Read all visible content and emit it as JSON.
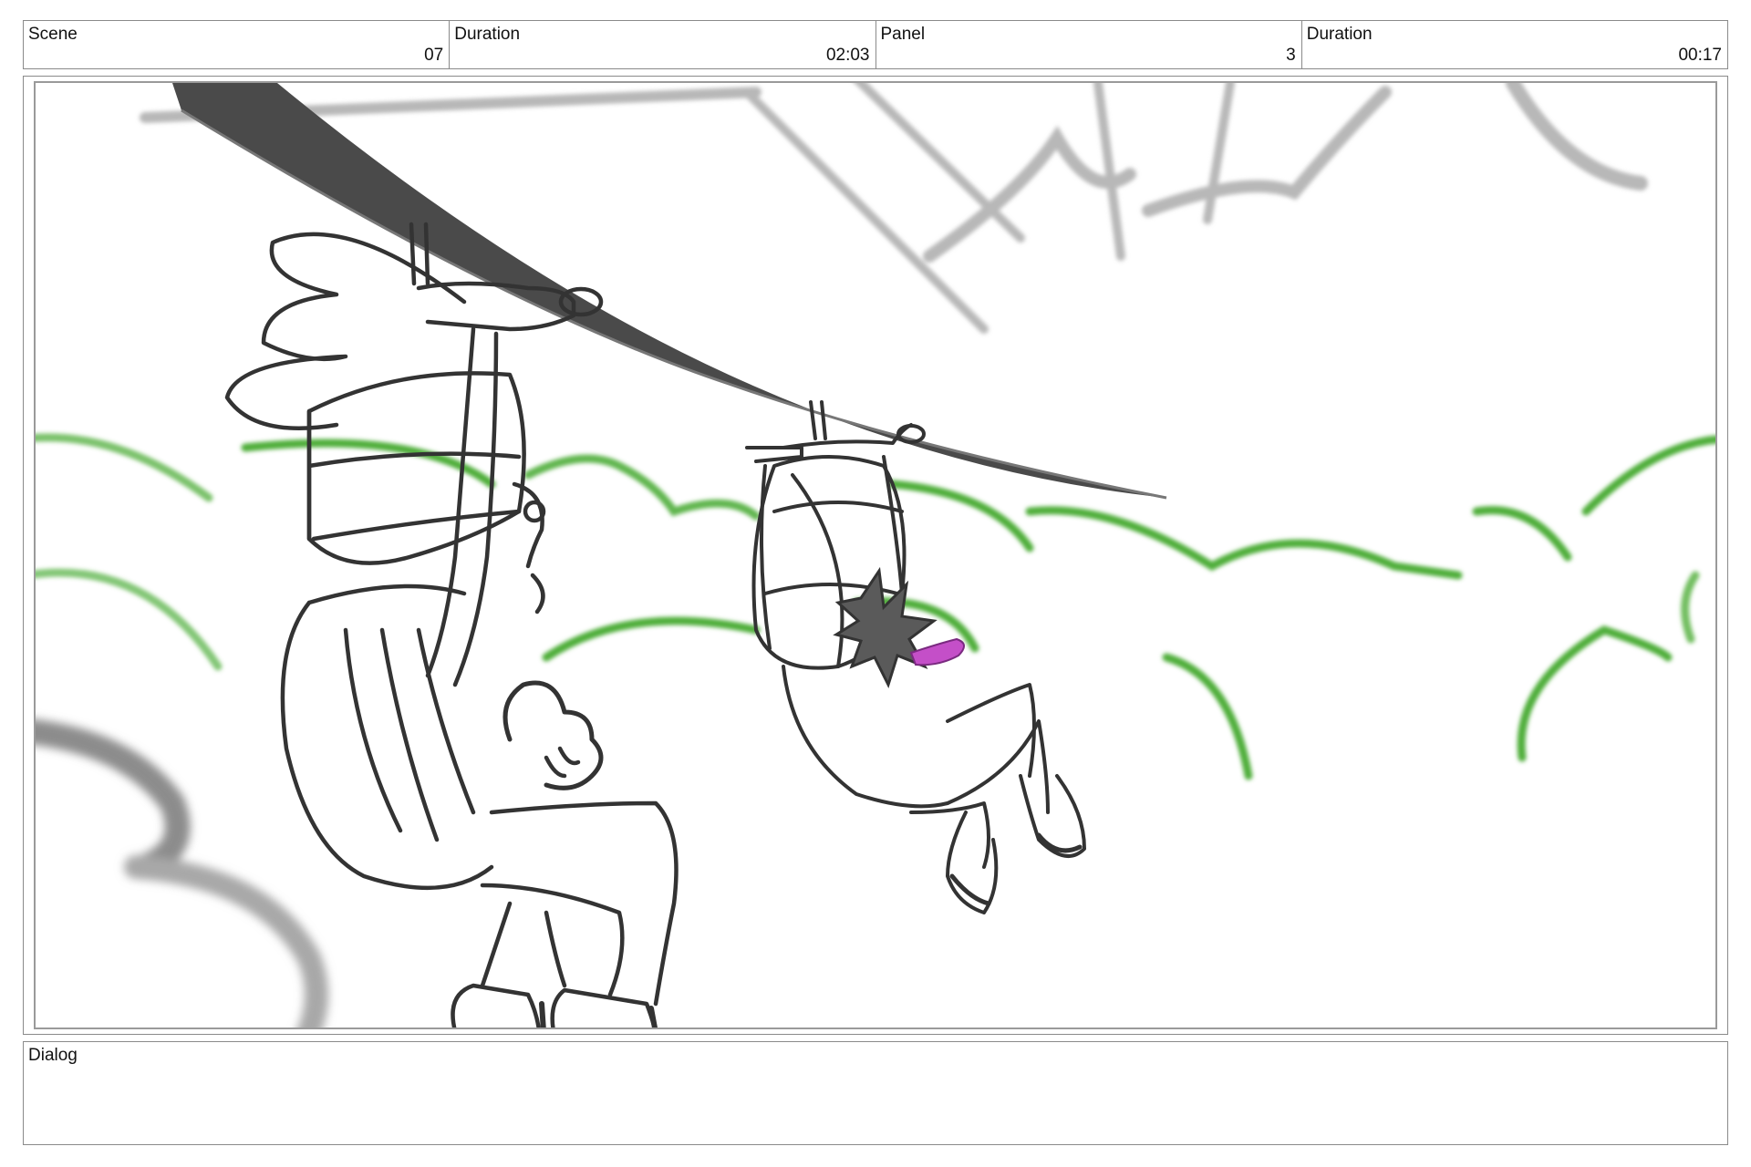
{
  "header": {
    "cells": [
      {
        "label": "Scene",
        "value": "07"
      },
      {
        "label": "Duration",
        "value": "02:03"
      },
      {
        "label": "Panel",
        "value": "3"
      },
      {
        "label": "Duration",
        "value": "00:17"
      }
    ]
  },
  "panel": {
    "image": "storyboard-sketch: two characters riding a zipline over green treetops",
    "colors": {
      "ink": "#3a3a3a",
      "zipline": "#4a4a4a",
      "trees": "#4fae3a",
      "accent": "#c44fc8",
      "blur": "#b0b0b0"
    }
  },
  "dialog": {
    "label": "Dialog",
    "text": ""
  }
}
